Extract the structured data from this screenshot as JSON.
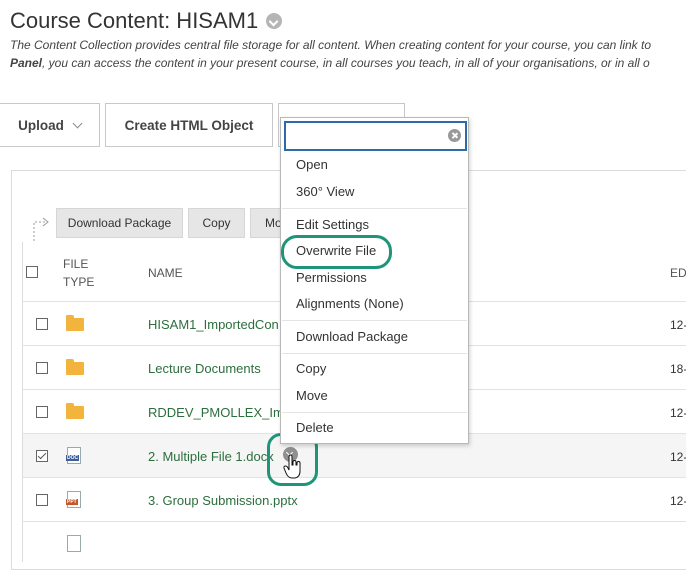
{
  "header": {
    "title": "Course Content: HISAM1",
    "description_line1": "The Content Collection provides central file storage for all content. When creating content for your course, you can link to",
    "description_line2_bold": "Panel",
    "description_line2_rest": ", you can access the content in your present course, in all courses you teach, in all of your organisations, or in all o"
  },
  "toolbar": {
    "upload_label": "Upload",
    "create_html_label": "Create HTML Object"
  },
  "actions": {
    "download_package_label": "Download Package",
    "copy_label": "Copy",
    "move_label": "Mo"
  },
  "table": {
    "columns": {
      "file_type": [
        "FILE",
        "TYPE"
      ],
      "name": "NAME",
      "date": "ED"
    },
    "rows": [
      {
        "name": "HISAM1_ImportedCon",
        "date": "12-",
        "icon": "folder-icon",
        "checked": false
      },
      {
        "name": "Lecture Documents",
        "date": "18-",
        "icon": "folder-icon",
        "checked": false
      },
      {
        "name": "RDDEV_PMOLLEX_Imp",
        "date": "12-",
        "icon": "folder-icon",
        "checked": false
      },
      {
        "name": "2. Multiple File 1.docx",
        "date": "12-",
        "icon": "docx-file-icon",
        "badge": "DOC",
        "checked": true
      },
      {
        "name": "3. Group Submission.pptx",
        "date": "12-",
        "icon": "pptx-file-icon",
        "badge": "PPT",
        "checked": false
      }
    ]
  },
  "menu": {
    "search_placeholder": "",
    "items": [
      {
        "label": "Open"
      },
      {
        "label": "360° View"
      },
      {
        "label": "Edit Settings"
      },
      {
        "label": "Overwrite File"
      },
      {
        "label": "Permissions"
      },
      {
        "label": "Alignments (None)"
      },
      {
        "label": "Download Package"
      },
      {
        "label": "Copy"
      },
      {
        "label": "Move"
      },
      {
        "label": "Delete"
      }
    ]
  },
  "colors": {
    "link": "#2d6e3e",
    "highlight": "#1e9479",
    "focus": "#2c6aa8",
    "folder": "#f2b43c"
  }
}
